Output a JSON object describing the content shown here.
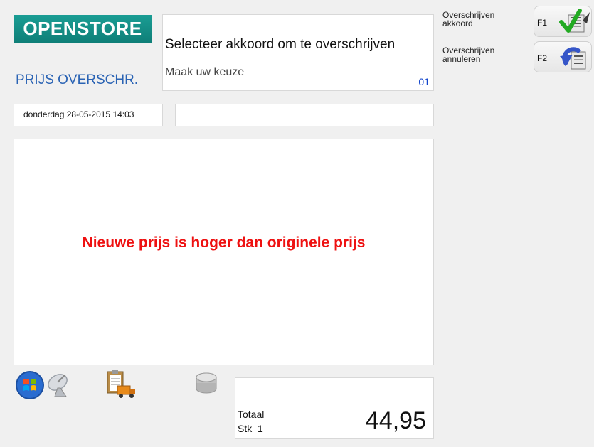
{
  "header": {
    "brand": "OPENSTORE",
    "mode_title": "PRIJS OVERSCHR."
  },
  "prompt": {
    "main": "Selecteer akkoord om te overschrijven",
    "sub": "Maak uw keuze",
    "code": "01"
  },
  "status": {
    "datetime": "donderdag 28-05-2015 14:03",
    "secondary": ""
  },
  "message": {
    "text": "Nieuwe prijs is hoger dan originele prijs",
    "color": "#ee1111"
  },
  "totals": {
    "label": "Totaal",
    "stk_label": "Stk",
    "stk_value": "1",
    "amount": "44,95"
  },
  "functions": [
    {
      "label_line1": "Overschrijven",
      "label_line2": "akkoord",
      "key": "F1",
      "icon": "check-icon"
    },
    {
      "label_line1": "Overschrijven",
      "label_line2": "annuleren",
      "key": "F2",
      "icon": "undo-icon"
    }
  ],
  "taskbar_icons": [
    "windows-icon",
    "satellite-dish-icon",
    "clipboard-truck-icon",
    "database-icon"
  ],
  "colors": {
    "brand": "#0f7f78",
    "mode_title": "#2a63b4",
    "code": "#1144cc"
  }
}
